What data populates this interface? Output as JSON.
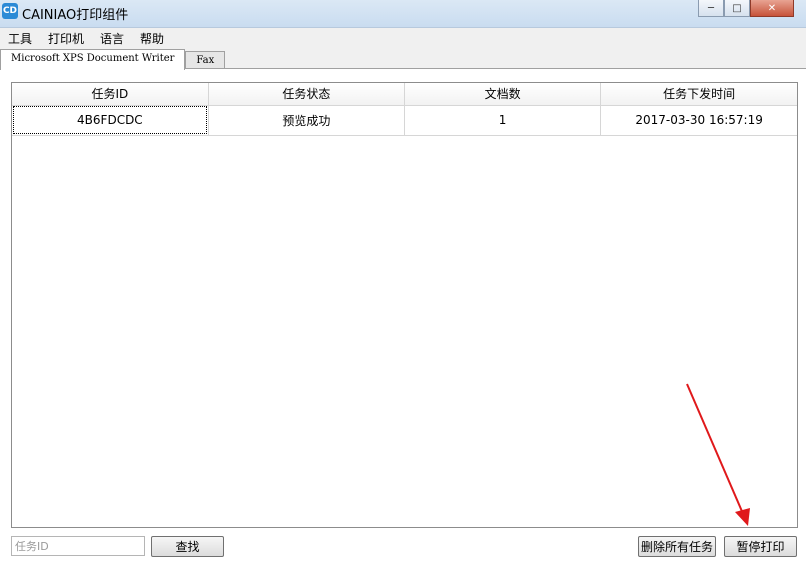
{
  "window": {
    "title": "CAINIAO打印组件",
    "icon_text": "CD"
  },
  "menu": [
    "工具",
    "打印机",
    "语言",
    "帮助"
  ],
  "tabs": [
    {
      "label": "Microsoft XPS Document Writer",
      "active": true
    },
    {
      "label": "Fax",
      "active": false
    }
  ],
  "table": {
    "columns": [
      "任务ID",
      "任务状态",
      "文档数",
      "任务下发时间"
    ],
    "rows": [
      [
        "4B6FDCDC",
        "预览成功",
        "1",
        "2017-03-30 16:57:19"
      ]
    ]
  },
  "bottom": {
    "search_placeholder": "任务ID",
    "find_label": "查找",
    "delete_all_label": "删除所有任务",
    "pause_label": "暂停打印"
  },
  "annotation": {
    "arrow_color": "#e0191b"
  }
}
